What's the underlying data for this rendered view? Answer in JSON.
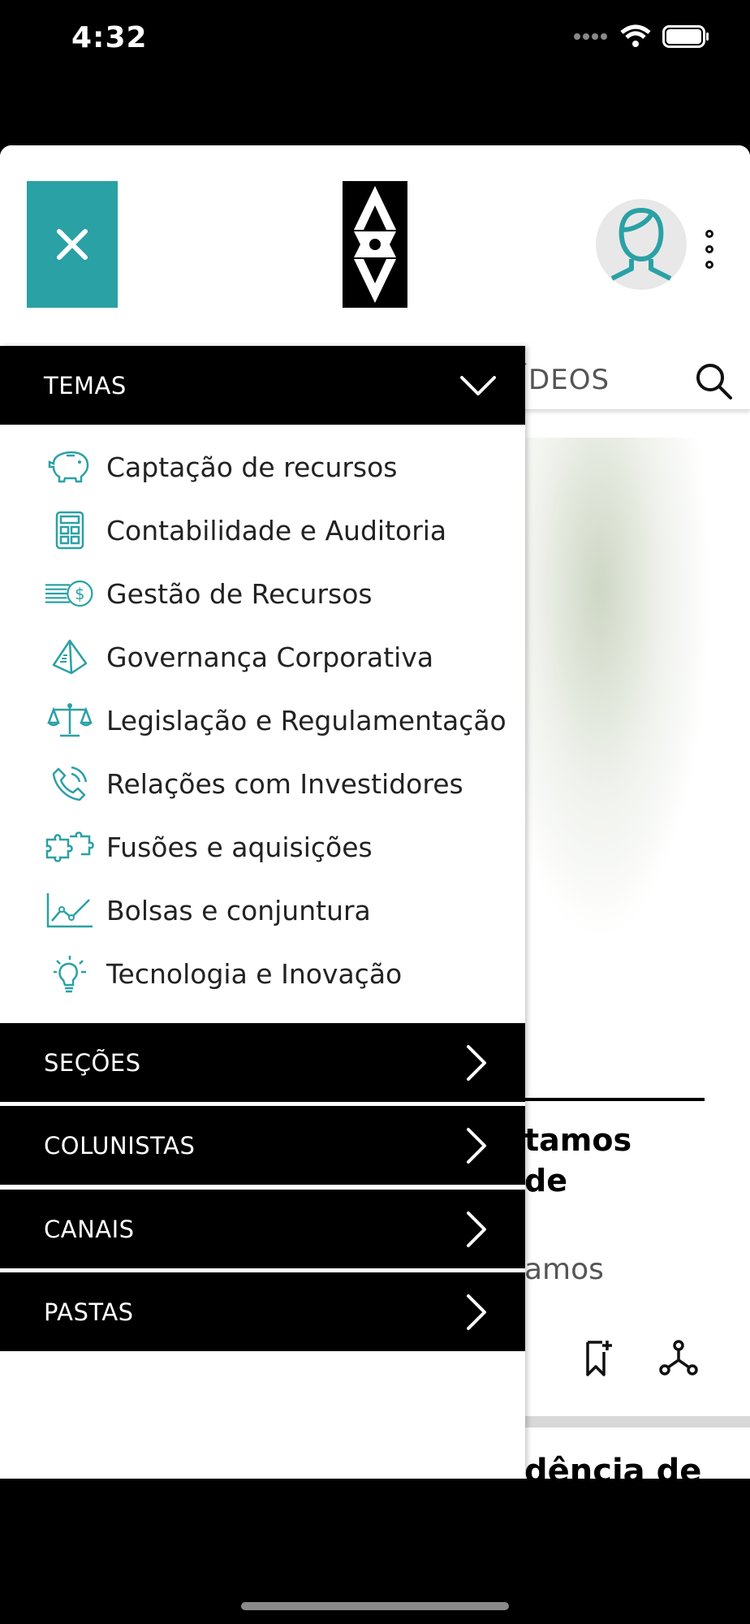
{
  "status_bar": {
    "time": "4:32"
  },
  "background": {
    "tab_partial": "ÍDEOS",
    "headline": "tamos\n de",
    "subtitle": "amos",
    "next_headline_partial": "dência de"
  },
  "menu": {
    "temas_label": "TEMAS",
    "topics": [
      {
        "icon": "piggy-bank-icon",
        "label": "Captação de recursos"
      },
      {
        "icon": "calculator-icon",
        "label": "Contabilidade e Auditoria"
      },
      {
        "icon": "coin-speed-icon",
        "label": "Gestão de Recursos"
      },
      {
        "icon": "pyramid-icon",
        "label": "Governança Corporativa"
      },
      {
        "icon": "scales-icon",
        "label": "Legislação e Regulamentação"
      },
      {
        "icon": "phone-icon",
        "label": "Relações com Investidores"
      },
      {
        "icon": "puzzle-icon",
        "label": "Fusões e aquisições"
      },
      {
        "icon": "line-chart-icon",
        "label": "Bolsas e conjuntura"
      },
      {
        "icon": "lightbulb-icon",
        "label": "Tecnologia e Inovação"
      }
    ],
    "sections": [
      {
        "label": "SEÇÕES"
      },
      {
        "label": "COLUNISTAS"
      },
      {
        "label": "CANAIS"
      },
      {
        "label": "PASTAS"
      }
    ]
  },
  "colors": {
    "accent": "#2aa1a5",
    "menu_bar": "#000000"
  }
}
